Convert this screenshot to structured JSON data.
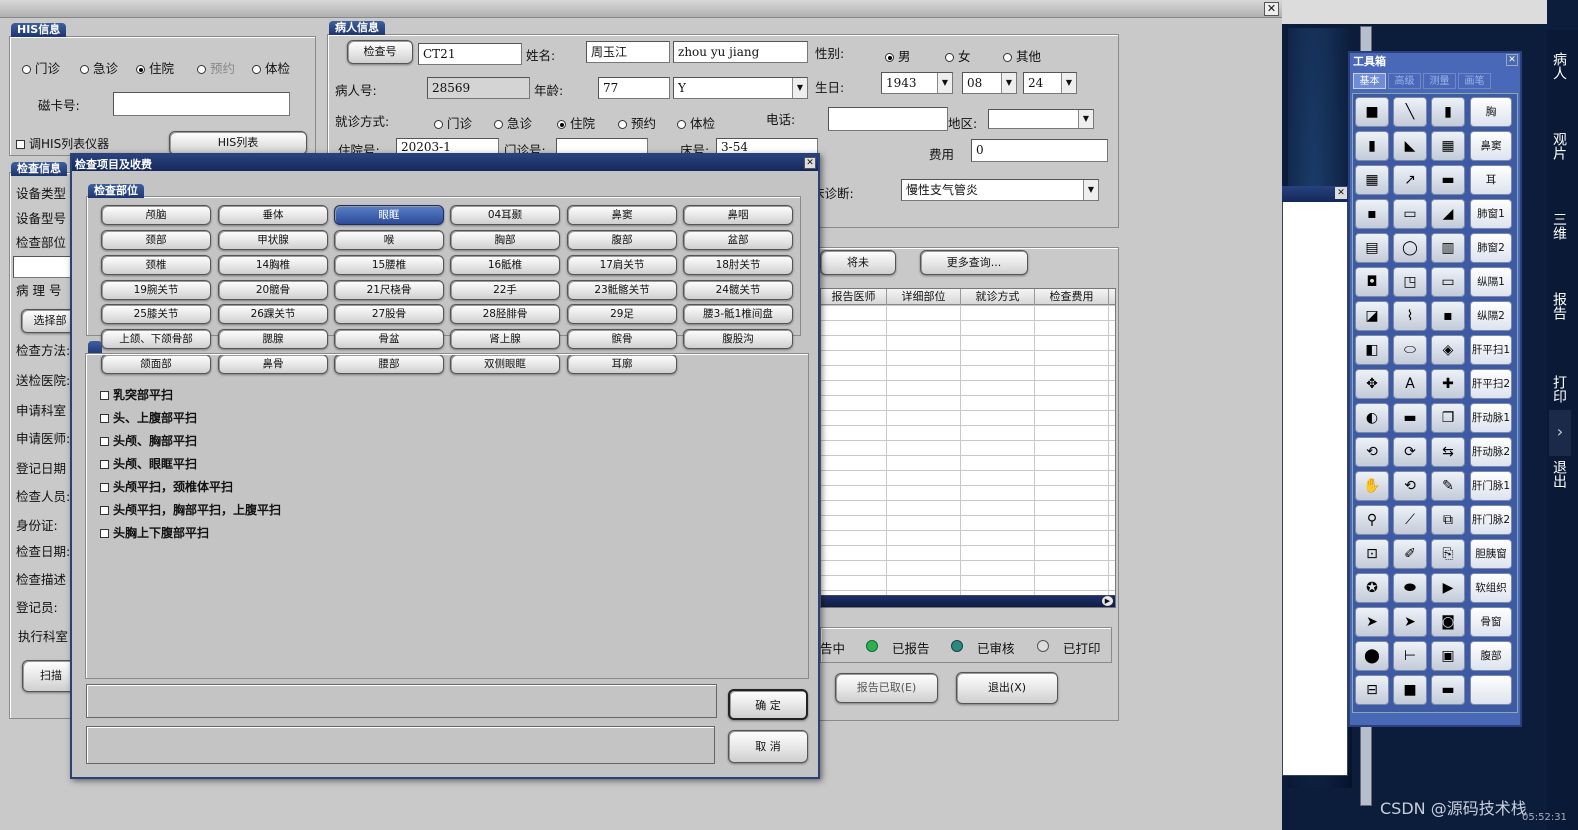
{
  "his": {
    "title": "HIS信息",
    "radios": [
      "门诊",
      "急诊",
      "住院",
      "预约",
      "体检"
    ],
    "card_label": "磁卡号:",
    "chk_label": "调HIS列表仪器",
    "list_btn": "HIS列表"
  },
  "exam": {
    "title": "检查信息",
    "labels": [
      "设备类型",
      "设备型号",
      "检查部位",
      "病 理 号",
      "检查方法:",
      "送检医院:",
      "申请科室",
      "申请医师:",
      "登记日期",
      "检查人员:",
      "身份证:",
      "检查日期:",
      "检查描述",
      "登记员:",
      "执行科室"
    ],
    "select_btn": "选择部",
    "scan_btn": "扫描"
  },
  "patient": {
    "title": "病人信息",
    "exam_no_btn": "检查号",
    "exam_no": "CT21",
    "name_label": "姓名:",
    "name": "周玉江",
    "pinyin": "zhou yu jiang",
    "gender_label": "性别:",
    "genders": [
      "男",
      "女",
      "其他"
    ],
    "pid_label": "病人号:",
    "pid": "28569",
    "age_label": "年龄:",
    "age": "77",
    "age_unit": "Y",
    "birth_label": "生日:",
    "birth_y": "1943",
    "birth_m": "08",
    "birth_d": "24",
    "visit_label": "就诊方式:",
    "visits": [
      "门诊",
      "急诊",
      "住院",
      "预约",
      "体检"
    ],
    "phone_label": "电话:",
    "region_label": "地区:",
    "inpatient_label": "住院号:",
    "inpatient": "20203-1",
    "outpatient_label": "门诊号:",
    "bed_label": "床号:",
    "bed": "3-54",
    "fee_label": "费用",
    "fee": "0",
    "diag_label": "床诊断:",
    "diag": "慢性支气管炎"
  },
  "list": {
    "btn_future": "将未",
    "btn_more": "更多查询...",
    "columns": [
      "报告医师",
      "详细部位",
      "就诊方式",
      "检查费用"
    ],
    "status": [
      "告中",
      "已报告",
      "已审核",
      "已打印"
    ],
    "btn_cancel_report": "报告已取(E)",
    "btn_exit": "退出(X)"
  },
  "dialog": {
    "title": "检查项目及收费",
    "group": "检查部位",
    "parts": [
      [
        "颅脑",
        "垂体",
        "眼眶",
        "04耳颞",
        "鼻窦",
        "鼻咽"
      ],
      [
        "颈部",
        "甲状腺",
        "喉",
        "胸部",
        "腹部",
        "盆部"
      ],
      [
        "颈椎",
        "14胸椎",
        "15腰椎",
        "16骶椎",
        "17肩关节",
        "18肘关节"
      ],
      [
        "19腕关节",
        "20髋骨",
        "21尺桡骨",
        "22手",
        "23骶髂关节",
        "24髋关节"
      ],
      [
        "25膝关节",
        "26踝关节",
        "27股骨",
        "28胫腓骨",
        "29足",
        "腰3-骶1椎间盘"
      ],
      [
        "上颌、下颌骨部",
        "腮腺",
        "骨盆",
        "肾上腺",
        "髌骨",
        "腹股沟"
      ],
      [
        "颌面部",
        "鼻骨",
        "腰部",
        "双侧眼眶",
        "耳廓"
      ]
    ],
    "items": [
      "乳突部平扫",
      "头、上腹部平扫",
      "头颅、胸部平扫",
      "头颅、眼眶平扫",
      "头颅平扫，颈椎体平扫",
      "头颅平扫，胸部平扫，上腹平扫",
      "头胸上下腹部平扫"
    ],
    "ok": "确 定",
    "cancel": "取 消"
  },
  "toolbox": {
    "title": "工具箱",
    "tabs": [
      "基本",
      "高级",
      "测量",
      "画笔"
    ],
    "labels": [
      "胸",
      "鼻窦",
      "耳",
      "肺窗1",
      "肺窗2",
      "纵隔1",
      "纵隔2",
      "肝平扫1",
      "肝平扫2",
      "肝动脉1",
      "肝动脉2",
      "肝门脉1",
      "肝门脉2",
      "胆胰窗",
      "软组织",
      "骨窗",
      "腹部",
      ""
    ]
  },
  "side": {
    "items": [
      "病人",
      "观片",
      "三维",
      "报告",
      "打印",
      "退出"
    ]
  },
  "watermark": "CSDN @源码技术栈",
  "clock": "05:52:31"
}
